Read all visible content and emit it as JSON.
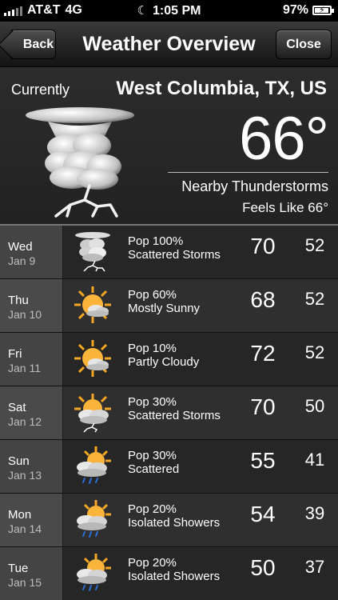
{
  "status_bar": {
    "carrier": "AT&T",
    "network": "4G",
    "time": "1:05 PM",
    "battery": "97%",
    "battery_level": 0.97
  },
  "nav": {
    "back_label": "Back",
    "title": "Weather Overview",
    "close_label": "Close"
  },
  "current": {
    "label": "Currently",
    "location": "West Columbia, TX, US",
    "temperature": "66°",
    "condition": "Nearby Thunderstorms",
    "feels_like": "Feels Like 66°",
    "icon": "thunderstorm-icon"
  },
  "forecast": [
    {
      "day": "Wed",
      "date": "Jan 9",
      "pop": "Pop 100%",
      "desc": "Scattered Storms",
      "high": "70",
      "low": "52",
      "icon": "thunderstorm-icon"
    },
    {
      "day": "Thu",
      "date": "Jan 10",
      "pop": "Pop 60%",
      "desc": "Mostly Sunny",
      "high": "68",
      "low": "52",
      "icon": "partly-cloudy-icon"
    },
    {
      "day": "Fri",
      "date": "Jan 11",
      "pop": "Pop 10%",
      "desc": "Partly Cloudy",
      "high": "72",
      "low": "52",
      "icon": "partly-cloudy-icon"
    },
    {
      "day": "Sat",
      "date": "Jan 12",
      "pop": "Pop 30%",
      "desc": "Scattered Storms",
      "high": "70",
      "low": "50",
      "icon": "sun-storm-icon"
    },
    {
      "day": "Sun",
      "date": "Jan 13",
      "pop": "Pop 30%",
      "desc": "Scattered",
      "high": "55",
      "low": "41",
      "icon": "sun-rain-icon"
    },
    {
      "day": "Mon",
      "date": "Jan 14",
      "pop": "Pop 20%",
      "desc": "Isolated Showers",
      "high": "54",
      "low": "39",
      "icon": "sun-rain-icon"
    },
    {
      "day": "Tue",
      "date": "Jan 15",
      "pop": "Pop 20%",
      "desc": "Isolated Showers",
      "high": "50",
      "low": "37",
      "icon": "sun-rain-icon"
    }
  ],
  "colors": {
    "background": "#262626",
    "day_cell": "#444444",
    "sun": "#f5a623",
    "cloud": "#d8d8d8"
  }
}
